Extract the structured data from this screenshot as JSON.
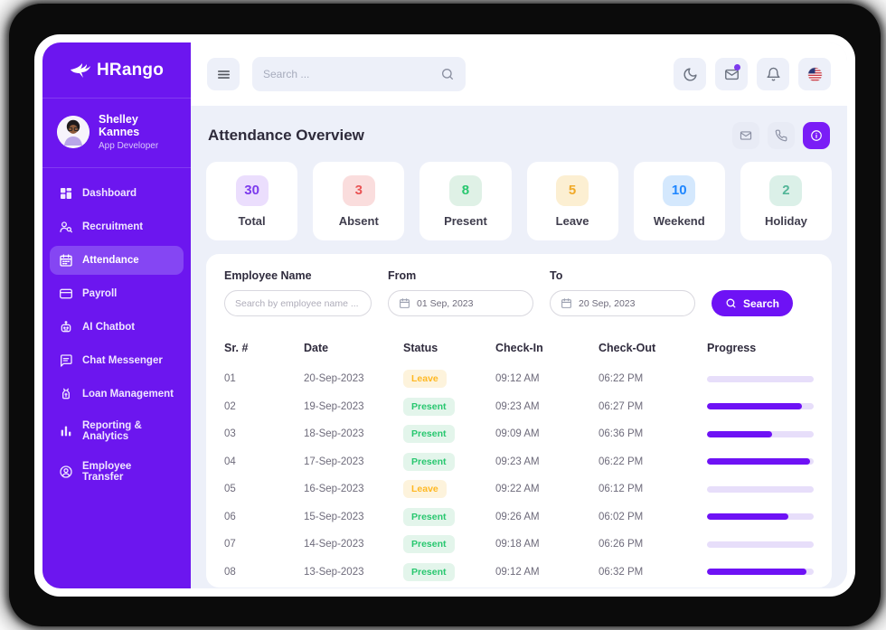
{
  "brand": {
    "name": "HRango",
    "logo_icon": "wing-icon"
  },
  "user": {
    "name": "Shelley Kannes",
    "role": "App Developer"
  },
  "sidebar": {
    "items": [
      {
        "label": "Dashboard",
        "icon": "dashboard-icon",
        "active": false
      },
      {
        "label": "Recruitment",
        "icon": "recruitment-icon",
        "active": false
      },
      {
        "label": "Attendance",
        "icon": "calendar-icon",
        "active": true
      },
      {
        "label": "Payroll",
        "icon": "payroll-icon",
        "active": false
      },
      {
        "label": "AI Chatbot",
        "icon": "robot-icon",
        "active": false
      },
      {
        "label": "Chat Messenger",
        "icon": "chat-icon",
        "active": false
      },
      {
        "label": "Loan Management",
        "icon": "loan-icon",
        "active": false
      },
      {
        "label": "Reporting & Analytics",
        "icon": "bar-chart-icon",
        "active": false
      },
      {
        "label": "Employee Transfer",
        "icon": "person-circle-icon",
        "active": false
      }
    ]
  },
  "topbar": {
    "search_placeholder": "Search ...",
    "icons": [
      "menu-icon",
      "search-icon",
      "moon-icon",
      "mail-icon",
      "bell-icon",
      "us-flag-icon"
    ]
  },
  "header": {
    "title": "Attendance Overview",
    "action_icons": [
      "mail-icon",
      "phone-icon",
      "info-icon"
    ]
  },
  "stats": [
    {
      "value": "30",
      "label": "Total",
      "color": "#7C3AED",
      "bg": "#EBDEFD"
    },
    {
      "value": "3",
      "label": "Absent",
      "color": "#EA5455",
      "bg": "#FADDDD"
    },
    {
      "value": "8",
      "label": "Present",
      "color": "#28C76F",
      "bg": "#DFF1E6"
    },
    {
      "value": "5",
      "label": "Leave",
      "color": "#F0A928",
      "bg": "#FCEFD2"
    },
    {
      "value": "10",
      "label": "Weekend",
      "color": "#1E86FF",
      "bg": "#D4E8FD"
    },
    {
      "value": "2",
      "label": "Holiday",
      "color": "#53B698",
      "bg": "#DBF0E8"
    }
  ],
  "filters": {
    "employee_name": {
      "label": "Employee Name",
      "placeholder": "Search by employee name ..."
    },
    "from": {
      "label": "From",
      "value": "01 Sep, 2023"
    },
    "to": {
      "label": "To",
      "value": "20 Sep, 2023"
    },
    "search_label": "Search"
  },
  "table": {
    "columns": [
      "Sr. #",
      "Date",
      "Status",
      "Check-In",
      "Check-Out",
      "Progress"
    ],
    "rows": [
      {
        "sr": "01",
        "date": "20-Sep-2023",
        "status": "Leave",
        "check_in": "09:12 AM",
        "check_out": "06:22 PM",
        "progress": 0
      },
      {
        "sr": "02",
        "date": "19-Sep-2023",
        "status": "Present",
        "check_in": "09:23 AM",
        "check_out": "06:27 PM",
        "progress": 89
      },
      {
        "sr": "03",
        "date": "18-Sep-2023",
        "status": "Present",
        "check_in": "09:09 AM",
        "check_out": "06:36 PM",
        "progress": 61
      },
      {
        "sr": "04",
        "date": "17-Sep-2023",
        "status": "Present",
        "check_in": "09:23 AM",
        "check_out": "06:22 PM",
        "progress": 97
      },
      {
        "sr": "05",
        "date": "16-Sep-2023",
        "status": "Leave",
        "check_in": "09:22 AM",
        "check_out": "06:12 PM",
        "progress": 0
      },
      {
        "sr": "06",
        "date": "15-Sep-2023",
        "status": "Present",
        "check_in": "09:26 AM",
        "check_out": "06:02 PM",
        "progress": 76
      },
      {
        "sr": "07",
        "date": "14-Sep-2023",
        "status": "Present",
        "check_in": "09:18 AM",
        "check_out": "06:26 PM",
        "progress": 0
      },
      {
        "sr": "08",
        "date": "13-Sep-2023",
        "status": "Present",
        "check_in": "09:12 AM",
        "check_out": "06:32 PM",
        "progress": 93
      }
    ]
  },
  "colors": {
    "sidebar": "#6C16EF",
    "sidebar_active": "#8546F3",
    "accent": "#6E12F5",
    "content_bg": "#EDF0F9",
    "progress_track": "#E7DEFA"
  }
}
